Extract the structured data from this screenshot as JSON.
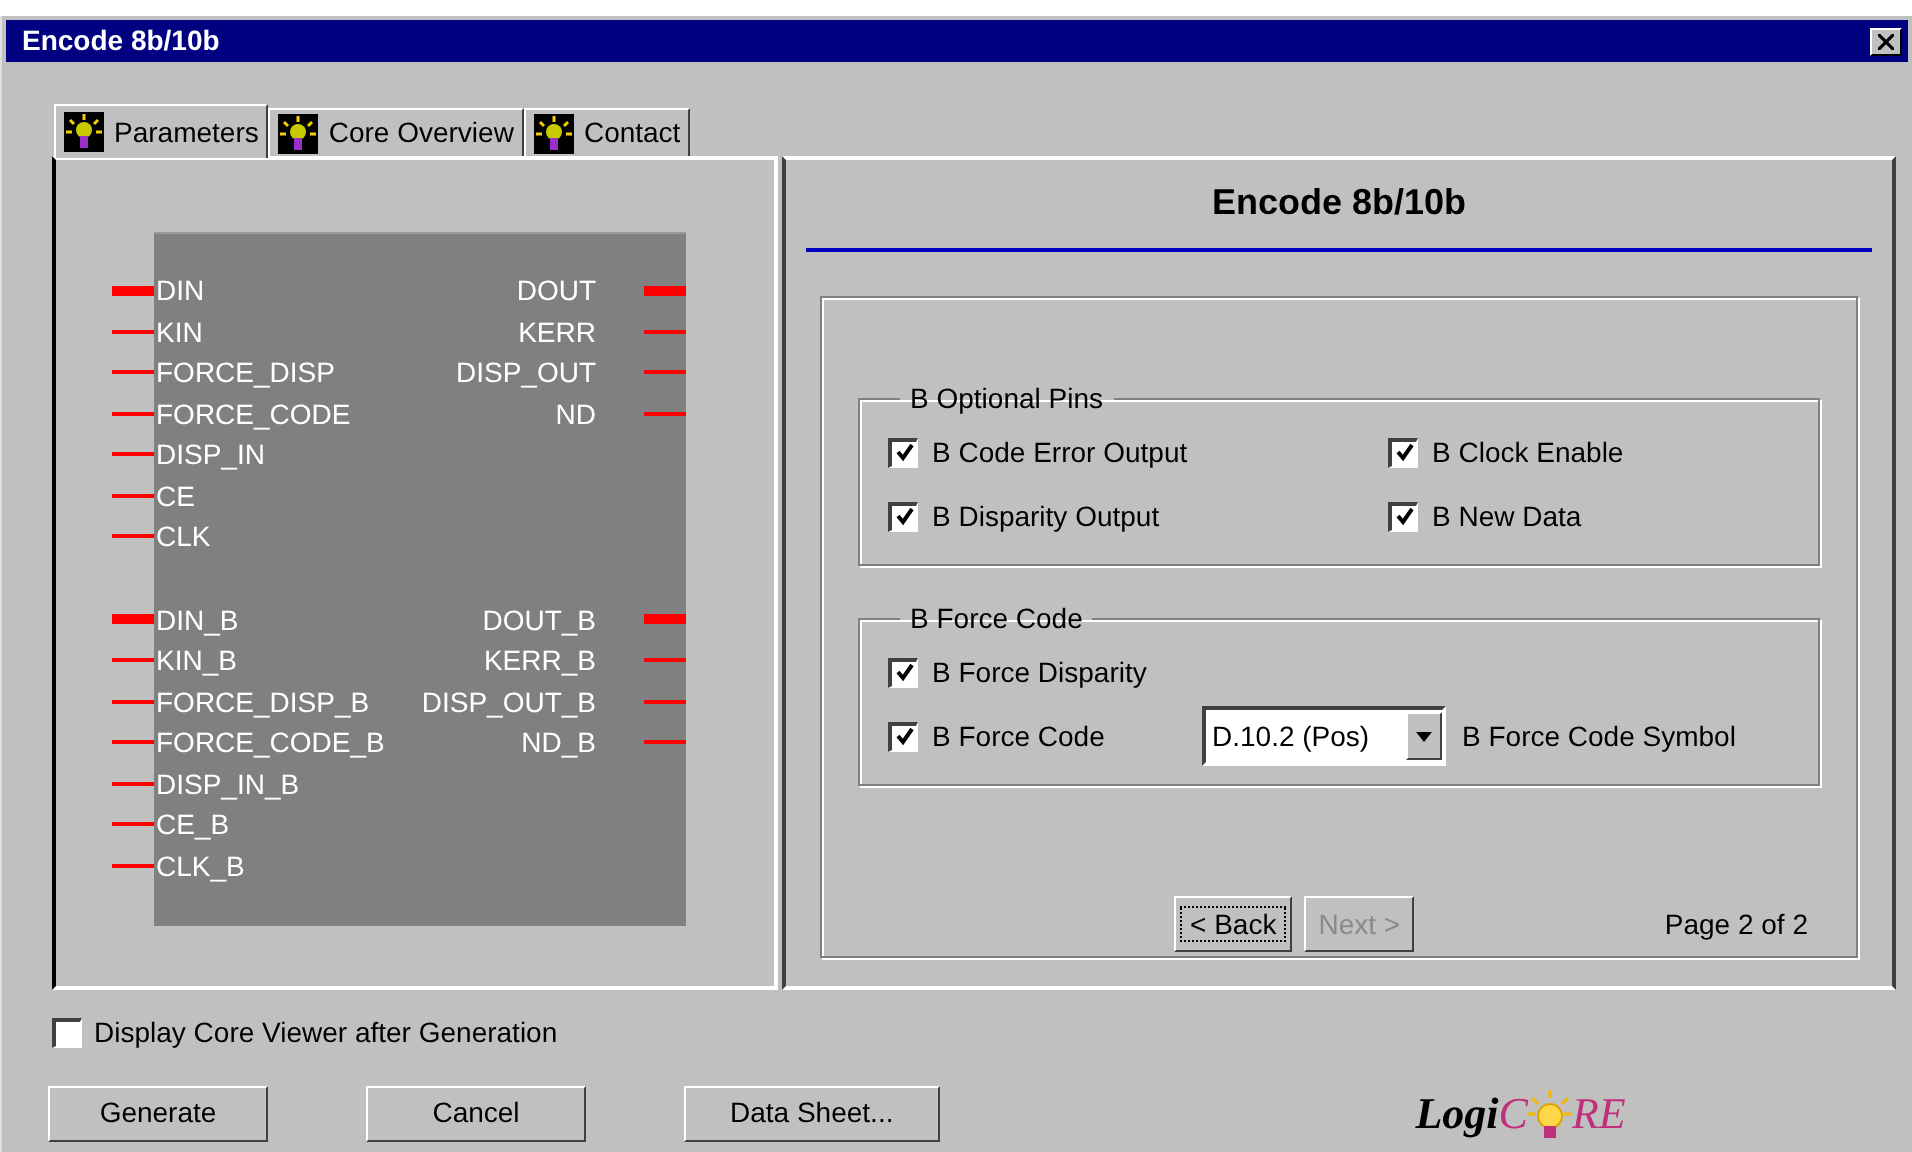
{
  "window": {
    "title": "Encode 8b/10b"
  },
  "tabs": [
    {
      "label": "Parameters",
      "selected": true
    },
    {
      "label": "Core Overview",
      "selected": false
    },
    {
      "label": "Contact",
      "selected": false
    }
  ],
  "symbol": {
    "groups": [
      {
        "inputs": [
          {
            "name": "DIN",
            "bus": true
          },
          {
            "name": "KIN",
            "bus": false
          },
          {
            "name": "FORCE_DISP",
            "bus": false
          },
          {
            "name": "FORCE_CODE",
            "bus": false
          },
          {
            "name": "DISP_IN",
            "bus": false
          },
          {
            "name": "CE",
            "bus": false
          },
          {
            "name": "CLK",
            "bus": false
          }
        ],
        "outputs": [
          {
            "name": "DOUT",
            "bus": true
          },
          {
            "name": "KERR",
            "bus": false
          },
          {
            "name": "DISP_OUT",
            "bus": false
          },
          {
            "name": "ND",
            "bus": false
          }
        ]
      },
      {
        "inputs": [
          {
            "name": "DIN_B",
            "bus": true
          },
          {
            "name": "KIN_B",
            "bus": false
          },
          {
            "name": "FORCE_DISP_B",
            "bus": false
          },
          {
            "name": "FORCE_CODE_B",
            "bus": false
          },
          {
            "name": "DISP_IN_B",
            "bus": false
          },
          {
            "name": "CE_B",
            "bus": false
          },
          {
            "name": "CLK_B",
            "bus": false
          }
        ],
        "outputs": [
          {
            "name": "DOUT_B",
            "bus": true
          },
          {
            "name": "KERR_B",
            "bus": false
          },
          {
            "name": "DISP_OUT_B",
            "bus": false
          },
          {
            "name": "ND_B",
            "bus": false
          }
        ]
      }
    ]
  },
  "panel": {
    "heading": "Encode 8b/10b",
    "groups": [
      {
        "legend": "B Optional Pins",
        "rows": [
          [
            {
              "kind": "checkbox",
              "label": "B Code Error Output",
              "checked": true
            },
            {
              "kind": "checkbox",
              "label": "B Clock Enable",
              "checked": true
            }
          ],
          [
            {
              "kind": "checkbox",
              "label": "B Disparity Output",
              "checked": true
            },
            {
              "kind": "checkbox",
              "label": "B New Data",
              "checked": true
            }
          ]
        ]
      },
      {
        "legend": "B Force Code",
        "rows": [
          [
            {
              "kind": "checkbox",
              "label": "B Force Disparity",
              "checked": true
            }
          ],
          [
            {
              "kind": "checkbox",
              "label": "B Force Code",
              "checked": true,
              "symbol_select": {
                "value": "D.10.2 (Pos)",
                "label": "B Force Code Symbol"
              }
            }
          ]
        ]
      }
    ],
    "nav": [
      {
        "label": "< Back",
        "disabled": false
      },
      {
        "label": "Next >",
        "disabled": true
      }
    ],
    "page": "Page 2 of 2"
  },
  "viewer_option": {
    "label": "Display Core Viewer after Generation",
    "checked": false
  },
  "buttons": [
    "Generate",
    "Cancel",
    "Data Sheet..."
  ],
  "logo": {
    "left": "Logi",
    "middle": "C",
    "right": "RE"
  }
}
